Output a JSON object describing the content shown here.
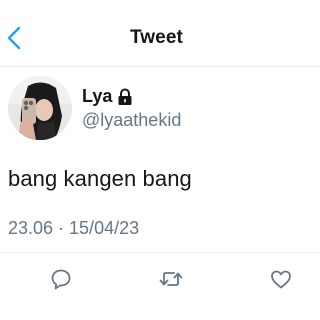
{
  "header": {
    "title": "Tweet",
    "back_icon": "chevron-left-icon",
    "accent_color": "#1da1f2"
  },
  "author": {
    "display_name": "Lya",
    "username": "@lyaathekid",
    "protected_icon": "lock-icon"
  },
  "tweet": {
    "text": "bang kangen bang",
    "timestamp": "23.06 · 15/04/23"
  },
  "actions": [
    {
      "icon": "reply-icon"
    },
    {
      "icon": "retweet-icon"
    },
    {
      "icon": "like-icon"
    }
  ],
  "colors": {
    "text": "#14171a",
    "secondary_text": "#657786",
    "icon_gray": "#657786"
  }
}
